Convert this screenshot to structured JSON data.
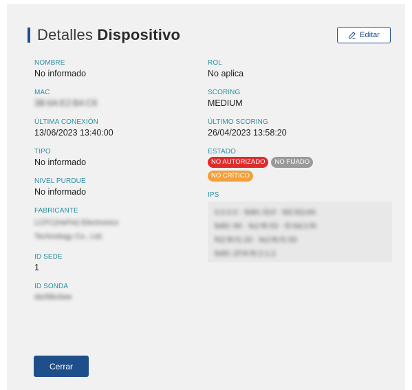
{
  "header": {
    "title_light": "Detalles",
    "title_bold": "Dispositivo",
    "edit_label": "Editar",
    "edit_icon": "pencil-icon"
  },
  "left": {
    "nombre": {
      "label": "NOMBRE",
      "value": "No informado"
    },
    "mac": {
      "label": "MAC",
      "value": "3B:6A:E2:B4:C8"
    },
    "ultima_conexion": {
      "label": "ÚLTIMA CONEXIÓN",
      "value": "13/06/2023 13:40:00"
    },
    "tipo": {
      "label": "TIPO",
      "value": "No informado"
    },
    "nivel_purdue": {
      "label": "NIVEL PURDUE",
      "value": "No informado"
    },
    "fabricante": {
      "label": "FABRICANTE",
      "value_line1": "LCFC(HeFei) Electronics",
      "value_line2": "Technology Co., Ltd."
    },
    "id_sede": {
      "label": "ID SEDE",
      "value": "1"
    },
    "id_sonda": {
      "label": "ID SONDA",
      "value": "da39bcbee"
    }
  },
  "right": {
    "rol": {
      "label": "ROL",
      "value": "No aplica"
    },
    "scoring": {
      "label": "SCORING",
      "value": "MEDIUM"
    },
    "ultimo_scoring": {
      "label": "ÚLTIMO SCORING",
      "value": "26/04/2023 13:58:20"
    },
    "estado": {
      "label": "ESTADO",
      "badges": [
        "NO AUTORIZADO",
        "NO FIJADO",
        "NO CRÍTICO"
      ]
    },
    "ips": {
      "label": "IPs",
      "lines": [
        "0.0.0.0 · fe80::f2cf · fd2:82c94",
        "fe80::90 · fe2:f6:53 · f2:6d:2:f0",
        "f02:f6:f1:20 · fe2:f6:f1:50",
        "fe80::2f:f4:f0:2:1:2"
      ]
    },
    "colors": {
      "red": "#e02b2b",
      "gray": "#9a9a9a",
      "orange": "#f2a03c"
    }
  },
  "footer": {
    "close_label": "Cerrar"
  }
}
